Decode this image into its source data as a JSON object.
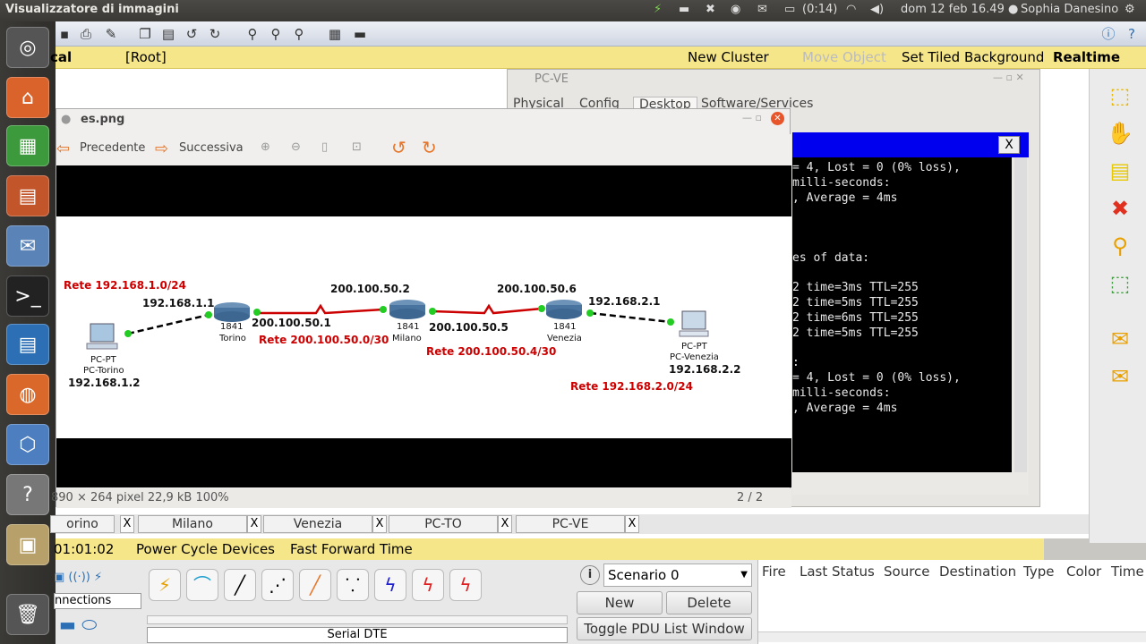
{
  "topbar": {
    "app_title": "Visualizzatore di immagini",
    "battery": "(0:14)",
    "datetime": "dom 12 feb 16.49",
    "user": "Sophia Danesino"
  },
  "yellowbar": {
    "logical": "cal",
    "root": "[Root]",
    "new_cluster": "New Cluster",
    "move_object": "Move Object",
    "tiled_bg": "Set Tiled Background",
    "realtime": "Realtime"
  },
  "pcve": {
    "title": "PC-VE",
    "tabs": [
      "Physical",
      "Config",
      "Desktop",
      "Software/Services"
    ],
    "terminal": "= 4, Lost = 0 (0% loss),\nmilli-seconds:\n, Average = 4ms\n\n\n\nes of data:\n\n2 time=3ms TTL=255\n2 time=5ms TTL=255\n2 time=6ms TTL=255\n2 time=5ms TTL=255\n\n:\n= 4, Lost = 0 (0% loss),\nmilli-seconds:\n, Average = 4ms"
  },
  "viewer": {
    "title": "es.png",
    "prev": "Precedente",
    "next": "Successiva",
    "info": "890 × 264 pixel  22,9 kB   100%",
    "page": "2 / 2"
  },
  "diagram": {
    "net1": "Rete 192.168.1.0/24",
    "pc_torino_ip": "192.168.1.2",
    "pc_torino_type": "PC-PT",
    "pc_torino_name": "PC-Torino",
    "r1_ip_left": "192.168.1.1",
    "r1_model": "1841",
    "r1_name": "Torino",
    "r1_ip_right": "200.100.50.1",
    "net2": "Rete 200.100.50.0/30",
    "r2_ip_left": "200.100.50.2",
    "r2_model": "1841",
    "r2_name": "Milano",
    "r2_ip_right": "200.100.50.5",
    "net3": "Rete 200.100.50.4/30",
    "r3_ip_left": "200.100.50.6",
    "r3_model": "1841",
    "r3_name": "Venezia",
    "r3_ip_right": "192.168.2.1",
    "pc_venezia_type": "PC-PT",
    "pc_venezia_name": "PC-Venezia",
    "pc_venezia_ip": "192.168.2.2",
    "net4": "Rete 192.168.2.0/24"
  },
  "ptabs": [
    "orino",
    "Milano",
    "Venezia",
    "PC-TO",
    "PC-VE"
  ],
  "timebar": {
    "time": "01:01:02",
    "power": "Power Cycle Devices",
    "fast": "Fast Forward Time"
  },
  "bottom": {
    "connections": "nnections",
    "cable": "Serial DTE",
    "scenario": "Scenario 0",
    "new": "New",
    "delete": "Delete",
    "toggle": "Toggle PDU List Window",
    "cols": [
      "Fire",
      "Last Status",
      "Source",
      "Destination",
      "Type",
      "Color",
      "Time"
    ]
  },
  "colors": {
    "serial": "#cc0000",
    "red_label": "#cc0000",
    "yellow": "#f6e68a"
  }
}
